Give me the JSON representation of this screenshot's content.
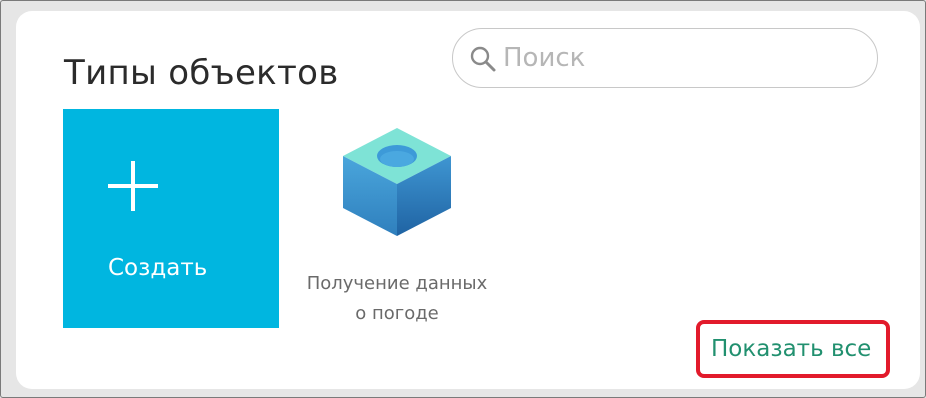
{
  "header": {
    "title": "Типы объектов"
  },
  "search": {
    "placeholder": "Поиск",
    "value": "",
    "icon": "search-icon"
  },
  "tiles": [
    {
      "label": "Создать",
      "icon": "plus-icon",
      "color": "#00b6e0"
    },
    {
      "label_line1": "Получение данных",
      "label_line2": "о погоде",
      "icon": "cube-icon"
    }
  ],
  "footer": {
    "show_all_label": "Показать все",
    "link_color": "#21906f",
    "highlight_color": "#e21a2b"
  }
}
